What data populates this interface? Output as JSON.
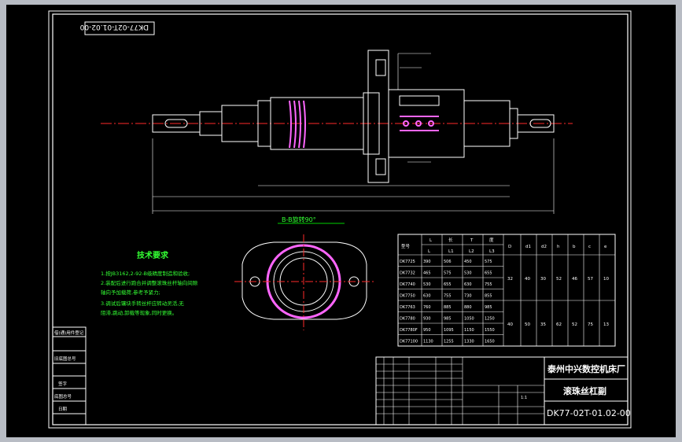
{
  "drawing_number_rot": "DK77-02T-01.02-00",
  "section_label": "B-B旋转90°",
  "tech_title": "技术要求",
  "tech_lines": [
    "1.按JB3162,2-92-B级精度制造和验收;",
    "2.装配后进行跑合并调整滚珠丝杆轴向间隙",
    "  轴向予加载荷,参考予紧力;",
    "3.调试后镶块手转丝杆应转动灵活,无",
    "  阻滞,跳动,卸载等现象,同时更换。"
  ],
  "table": {
    "header_top": [
      "型号",
      "L",
      "长",
      "T",
      "度",
      "D",
      "d1",
      "d2",
      "h",
      "b",
      "c",
      "e"
    ],
    "header_sub": [
      "L",
      "L1",
      "L2",
      "L3"
    ],
    "rows": [
      [
        "DK7725",
        "390",
        "506",
        "450",
        "575"
      ],
      [
        "DK7732",
        "465",
        "575",
        "530",
        "655"
      ],
      [
        "DK7740",
        "530",
        "655",
        "630",
        "755"
      ],
      [
        "DK7750",
        "630",
        "755",
        "730",
        "855"
      ],
      [
        "DK7763",
        "760",
        "885",
        "880",
        "985"
      ],
      [
        "DK7780",
        "930",
        "985",
        "1050",
        "1250"
      ],
      [
        "DK7780F",
        "950",
        "1095",
        "1150",
        "1550"
      ],
      [
        "DK77100",
        "1130",
        "1255",
        "1330",
        "1650"
      ]
    ],
    "group1": [
      "32",
      "40",
      "30",
      "52",
      "46",
      "57",
      "10"
    ],
    "group2": [
      "40",
      "50",
      "35",
      "62",
      "52",
      "75",
      "13"
    ]
  },
  "title_block": {
    "company": "泰州中兴数控机床厂",
    "part": "滚珠丝杠副",
    "drawing_number": "DK77-02T-01.02-00",
    "scale": "1:1"
  },
  "side_labels": [
    "借(通)用件登记",
    "旧底图总号",
    "底图总号",
    "签字",
    "日期"
  ]
}
